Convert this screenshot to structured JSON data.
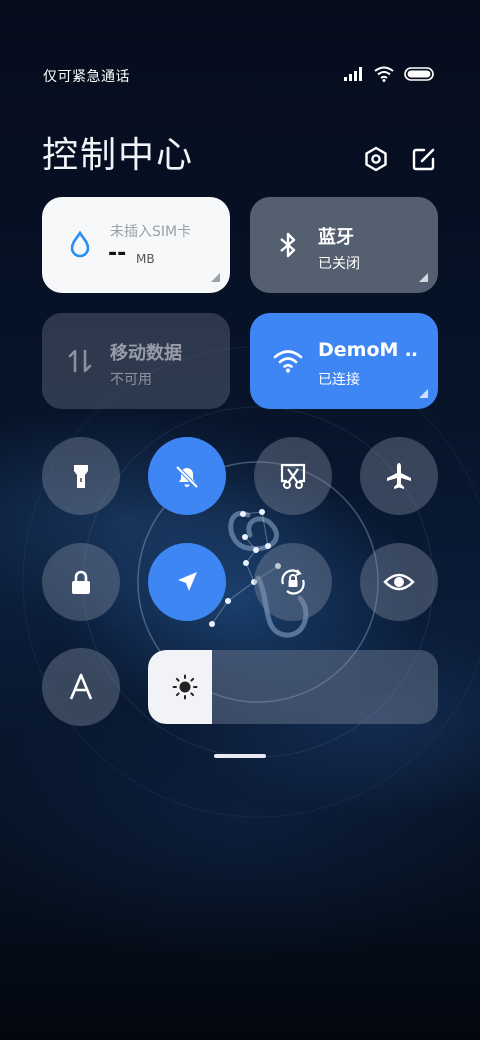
{
  "status_bar": {
    "carrier": "仅可紧急通话"
  },
  "header": {
    "title": "控制中心"
  },
  "tiles": {
    "data_usage": {
      "label": "未插入SIM卡",
      "value": "--",
      "unit": "MB"
    },
    "bluetooth": {
      "label": "蓝牙",
      "status": "已关闭"
    },
    "mobile_data": {
      "label": "移动数据",
      "status": "不可用"
    },
    "wifi": {
      "label": "DemoM ‥",
      "status": "已连接"
    }
  },
  "toggles": [
    {
      "name": "flashlight",
      "active": false
    },
    {
      "name": "mute",
      "active": true
    },
    {
      "name": "screenshot",
      "active": false
    },
    {
      "name": "airplane-mode",
      "active": false
    },
    {
      "name": "lock-screen",
      "active": false
    },
    {
      "name": "location",
      "active": true
    },
    {
      "name": "rotation-lock",
      "active": false
    },
    {
      "name": "eye-comfort",
      "active": false
    },
    {
      "name": "auto-brightness",
      "active": false
    }
  ],
  "brightness": {
    "level": 0.22
  },
  "colors": {
    "accent": "#3f86f5",
    "tile_white": "#f7f8fa"
  }
}
